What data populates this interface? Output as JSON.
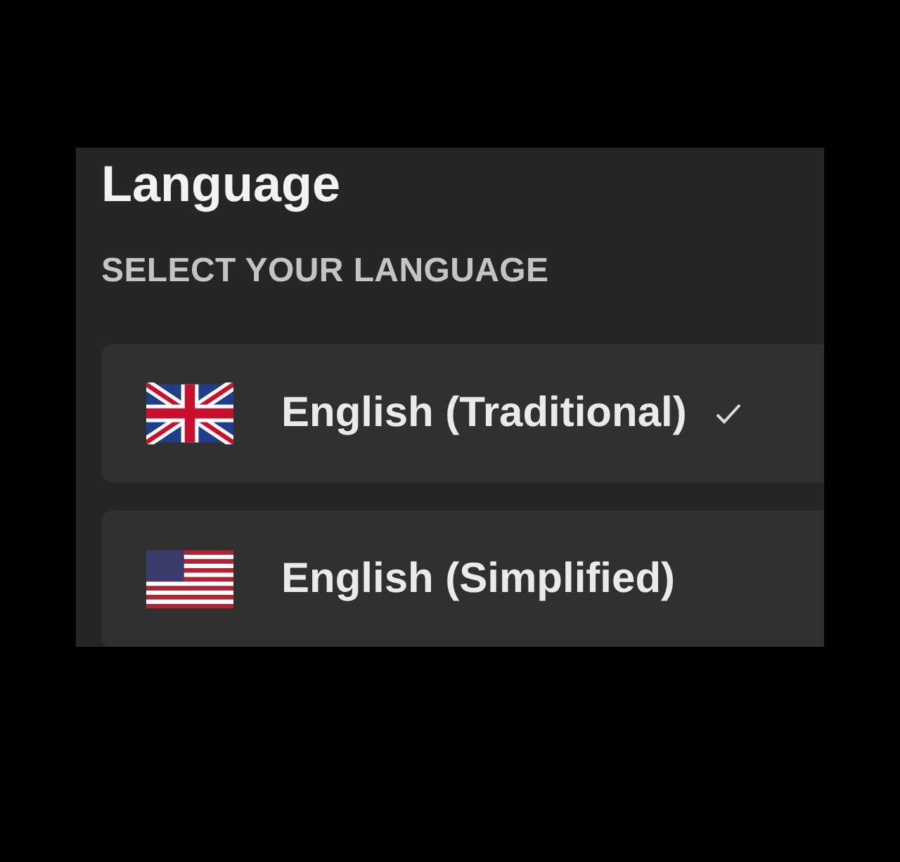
{
  "title": "Language",
  "subtitle": "SELECT YOUR LANGUAGE",
  "languages": [
    {
      "label": "English (Traditional)",
      "kind": "uk",
      "selected": true
    },
    {
      "label": "English (Simplified)",
      "kind": "us",
      "selected": false
    }
  ]
}
